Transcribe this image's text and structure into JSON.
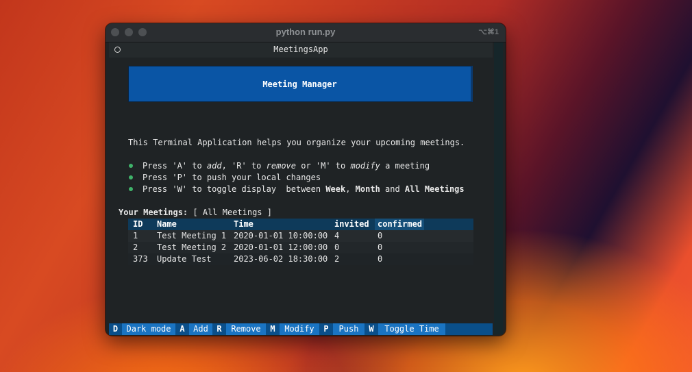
{
  "window": {
    "title": "python run.py",
    "shortcut": "⌥⌘1"
  },
  "app": {
    "header_title": "MeetingsApp",
    "banner": "Meeting Manager",
    "intro": "This Terminal Application helps you organize your upcoming meetings.",
    "bullets": {
      "b1": {
        "pre": "Press 'A' to ",
        "add": "add",
        "mid1": ", 'R' to ",
        "remove": "remove",
        "mid2": " or 'M' to ",
        "modify": "modify",
        "post": " a meeting"
      },
      "b2": {
        "text": "Press 'P' to push your local changes"
      },
      "b3": {
        "pre": "Press 'W' to toggle display  between ",
        "week": "Week",
        "sep": ", ",
        "month": "Month",
        "and": " and ",
        "all": "All Meetings"
      }
    },
    "your_meetings_label": "Your Meetings:",
    "filter_value": "[ All Meetings ]",
    "table": {
      "columns": [
        "ID",
        "Name",
        "Time",
        "invited",
        "confirmed"
      ],
      "rows": [
        [
          "1",
          "Test Meeting 1",
          "2020-01-01 10:00:00",
          "4",
          "0"
        ],
        [
          "2",
          "Test Meeting 2",
          "2020-01-01 12:00:00",
          "0",
          "0"
        ],
        [
          "373",
          "Update Test",
          "2023-06-02 18:30:00",
          "2",
          "0"
        ]
      ]
    },
    "footer": [
      {
        "key": "D",
        "label": "Dark mode"
      },
      {
        "key": "A",
        "label": "Add"
      },
      {
        "key": "R",
        "label": "Remove"
      },
      {
        "key": "M",
        "label": "Modify"
      },
      {
        "key": "P",
        "label": "Push"
      },
      {
        "key": "W",
        "label": "Toggle Time"
      }
    ]
  },
  "colors": {
    "banner": "#0a55a5",
    "footer": "#0a4f8a",
    "footer_label": "#1a74c2",
    "bullet": "#3fb36a",
    "table_header": "#0e3a5a"
  }
}
